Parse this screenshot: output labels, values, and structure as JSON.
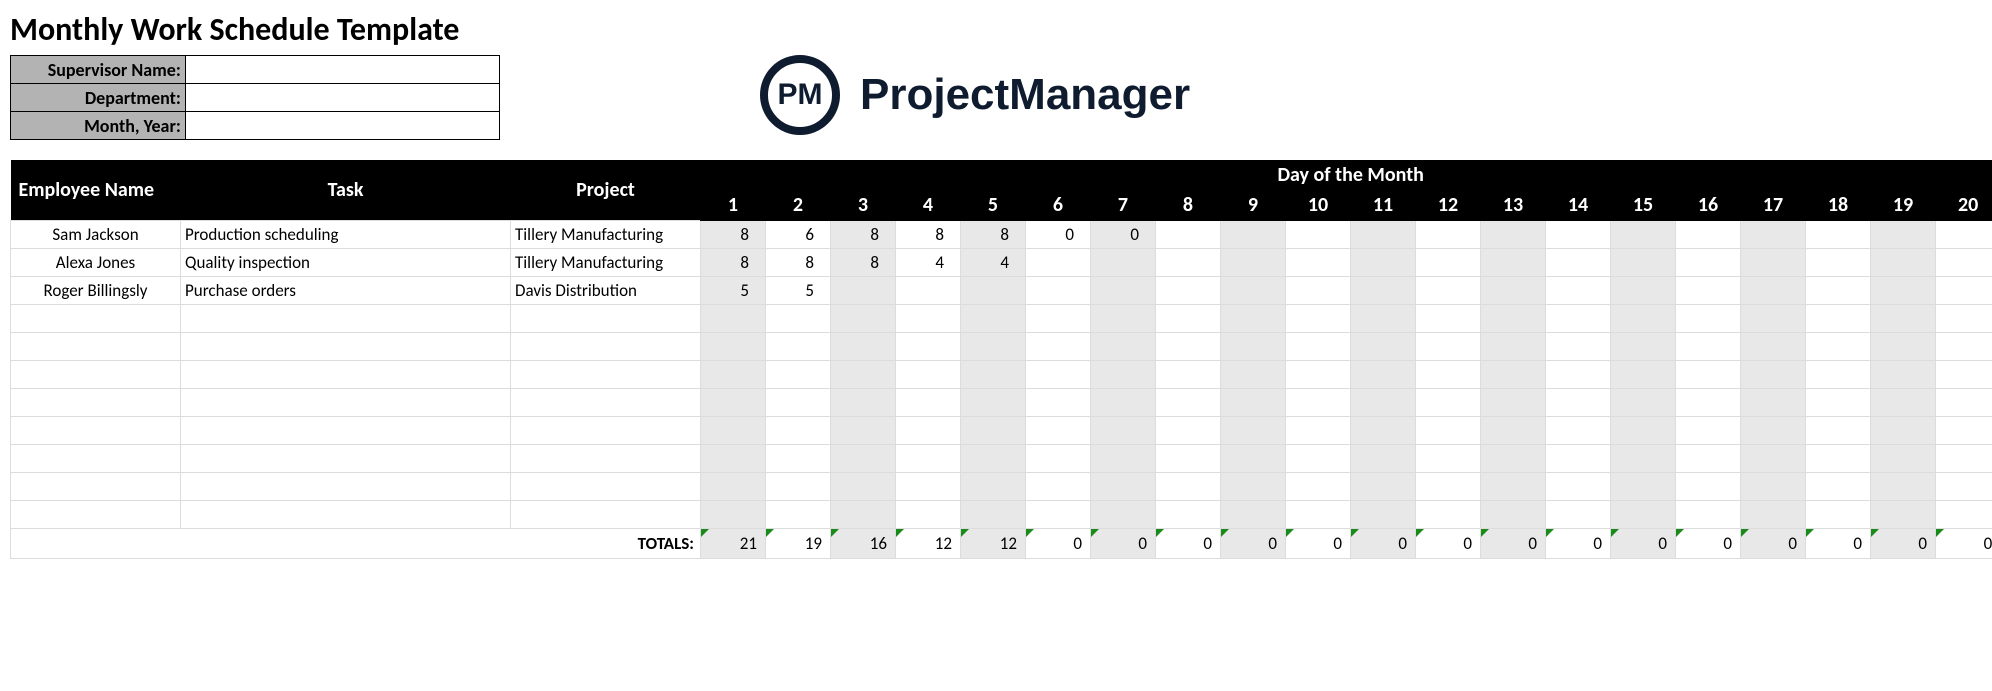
{
  "title": "Monthly Work Schedule Template",
  "meta": {
    "supervisor_label": "Supervisor Name:",
    "supervisor_value": "",
    "department_label": "Department:",
    "department_value": "",
    "month_label": "Month, Year:",
    "month_value": ""
  },
  "logo": {
    "badge": "PM",
    "text": "ProjectManager"
  },
  "headers": {
    "employee": "Employee Name",
    "task": "Task",
    "project": "Project",
    "day_group": "Day of the Month",
    "days": [
      "1",
      "2",
      "3",
      "4",
      "5",
      "6",
      "7",
      "8",
      "9",
      "10",
      "11",
      "12",
      "13",
      "14",
      "15",
      "16",
      "17",
      "18",
      "19",
      "20"
    ]
  },
  "rows": [
    {
      "employee": "Sam Jackson",
      "task": "Production scheduling",
      "project": "Tillery Manufacturing",
      "days": [
        "8",
        "6",
        "8",
        "8",
        "8",
        "0",
        "0",
        "",
        "",
        "",
        "",
        "",
        "",
        "",
        "",
        "",
        "",
        "",
        "",
        ""
      ]
    },
    {
      "employee": "Alexa Jones",
      "task": "Quality inspection",
      "project": "Tillery Manufacturing",
      "days": [
        "8",
        "8",
        "8",
        "4",
        "4",
        "",
        "",
        "",
        "",
        "",
        "",
        "",
        "",
        "",
        "",
        "",
        "",
        "",
        "",
        ""
      ]
    },
    {
      "employee": "Roger Billingsly",
      "task": "Purchase orders",
      "project": "Davis Distribution",
      "days": [
        "5",
        "5",
        "",
        "",
        "",
        "",
        "",
        "",
        "",
        "",
        "",
        "",
        "",
        "",
        "",
        "",
        "",
        "",
        "",
        ""
      ]
    },
    {
      "employee": "",
      "task": "",
      "project": "",
      "days": [
        "",
        "",
        "",
        "",
        "",
        "",
        "",
        "",
        "",
        "",
        "",
        "",
        "",
        "",
        "",
        "",
        "",
        "",
        "",
        ""
      ]
    },
    {
      "employee": "",
      "task": "",
      "project": "",
      "days": [
        "",
        "",
        "",
        "",
        "",
        "",
        "",
        "",
        "",
        "",
        "",
        "",
        "",
        "",
        "",
        "",
        "",
        "",
        "",
        ""
      ]
    },
    {
      "employee": "",
      "task": "",
      "project": "",
      "days": [
        "",
        "",
        "",
        "",
        "",
        "",
        "",
        "",
        "",
        "",
        "",
        "",
        "",
        "",
        "",
        "",
        "",
        "",
        "",
        ""
      ]
    },
    {
      "employee": "",
      "task": "",
      "project": "",
      "days": [
        "",
        "",
        "",
        "",
        "",
        "",
        "",
        "",
        "",
        "",
        "",
        "",
        "",
        "",
        "",
        "",
        "",
        "",
        "",
        ""
      ]
    },
    {
      "employee": "",
      "task": "",
      "project": "",
      "days": [
        "",
        "",
        "",
        "",
        "",
        "",
        "",
        "",
        "",
        "",
        "",
        "",
        "",
        "",
        "",
        "",
        "",
        "",
        "",
        ""
      ]
    },
    {
      "employee": "",
      "task": "",
      "project": "",
      "days": [
        "",
        "",
        "",
        "",
        "",
        "",
        "",
        "",
        "",
        "",
        "",
        "",
        "",
        "",
        "",
        "",
        "",
        "",
        "",
        ""
      ]
    },
    {
      "employee": "",
      "task": "",
      "project": "",
      "days": [
        "",
        "",
        "",
        "",
        "",
        "",
        "",
        "",
        "",
        "",
        "",
        "",
        "",
        "",
        "",
        "",
        "",
        "",
        "",
        ""
      ]
    },
    {
      "employee": "",
      "task": "",
      "project": "",
      "days": [
        "",
        "",
        "",
        "",
        "",
        "",
        "",
        "",
        "",
        "",
        "",
        "",
        "",
        "",
        "",
        "",
        "",
        "",
        "",
        ""
      ]
    }
  ],
  "totals": {
    "label": "TOTALS:",
    "values": [
      "21",
      "19",
      "16",
      "12",
      "12",
      "0",
      "0",
      "0",
      "0",
      "0",
      "0",
      "0",
      "0",
      "0",
      "0",
      "0",
      "0",
      "0",
      "0",
      "0"
    ]
  }
}
